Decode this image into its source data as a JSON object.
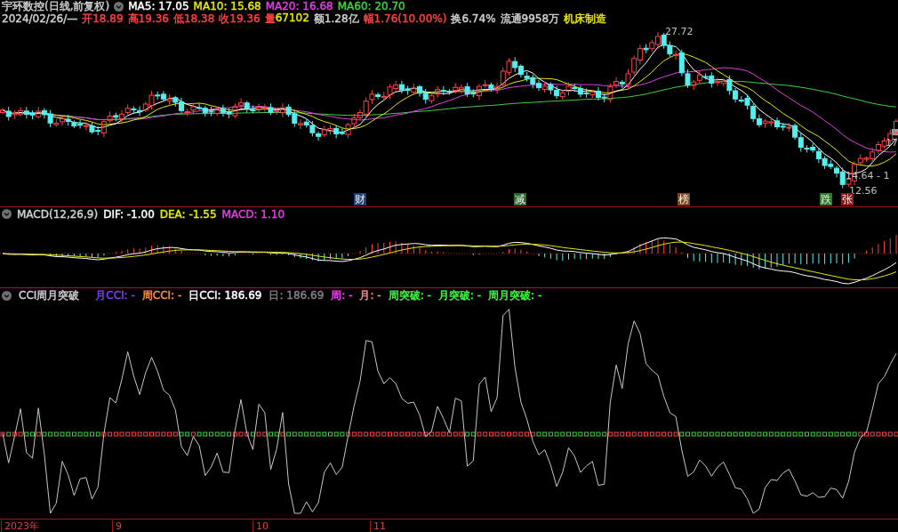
{
  "header": {
    "title": "宇环数控(日线,前复权)",
    "ma": [
      {
        "text": "MA5: 17.05",
        "color": "#ffffff"
      },
      {
        "text": "MA10: 15.68",
        "color": "#e8e800"
      },
      {
        "text": "MA20: 16.68",
        "color": "#e040e0"
      },
      {
        "text": "MA60: 20.70",
        "color": "#40d040"
      }
    ]
  },
  "quote": {
    "date": "2024/02/26/—",
    "items": [
      {
        "parts": [
          {
            "text": "开18.89",
            "color": "#ff4040"
          }
        ]
      },
      {
        "parts": [
          {
            "text": "高19.36",
            "color": "#ff4040"
          }
        ]
      },
      {
        "parts": [
          {
            "text": "低18.38",
            "color": "#ff4040"
          }
        ]
      },
      {
        "parts": [
          {
            "text": "收19.36",
            "color": "#ff4040"
          }
        ]
      },
      {
        "parts": [
          {
            "text": "量",
            "color": "#ff4040"
          },
          {
            "text": "67102",
            "color": "#e8e800"
          }
        ]
      },
      {
        "parts": [
          {
            "text": "额1.28亿",
            "color": "#d0d0d0"
          }
        ]
      },
      {
        "parts": [
          {
            "text": "幅1.76(10.00%)",
            "color": "#ff4040"
          }
        ]
      },
      {
        "parts": [
          {
            "text": "换6.74%",
            "color": "#d0d0d0"
          }
        ]
      },
      {
        "parts": [
          {
            "text": "流通9958万",
            "color": "#d0d0d0"
          }
        ]
      },
      {
        "parts": [
          {
            "text": "机床制造",
            "color": "#e8e800"
          }
        ]
      }
    ]
  },
  "price_chart": {
    "labels": [
      "27.72",
      "14.64 - 1",
      "12.56",
      "17"
    ],
    "markers": [
      {
        "text": "财",
        "color": "#1e3f7a"
      },
      {
        "text": "减",
        "color": "#2a6a2a"
      },
      {
        "text": "榜",
        "color": "#7a4a1a"
      },
      {
        "text": "跌",
        "color": "#2a7a2a"
      },
      {
        "text": "张",
        "color": "#8a1a1a"
      }
    ]
  },
  "macd": {
    "title": "MACD(12,26,9)",
    "values": [
      {
        "text": "DIF: -1.00",
        "color": "#ffffff"
      },
      {
        "text": "DEA: -1.55",
        "color": "#e8e800"
      },
      {
        "text": "MACD: 1.10",
        "color": "#e040e0"
      }
    ]
  },
  "cci": {
    "title": "CCI周月突破",
    "values": [
      {
        "text": "月CCI: -",
        "color": "#8040ff"
      },
      {
        "text": "周CCI: -",
        "color": "#ff9040"
      },
      {
        "text": "日CCI: 186.69",
        "color": "#ffffff"
      },
      {
        "text": "日: 186.69",
        "color": "#808080"
      },
      {
        "text": "周: -",
        "color": "#ff40ff"
      },
      {
        "text": "月: -",
        "color": "#ff9090"
      },
      {
        "text": "周突破: -",
        "color": "#40ff40"
      },
      {
        "text": "月突破: -",
        "color": "#40ff40"
      },
      {
        "text": "周月突破: -",
        "color": "#40ff40"
      }
    ]
  },
  "time_axis": [
    "2023年",
    "9",
    "10",
    "11"
  ]
}
